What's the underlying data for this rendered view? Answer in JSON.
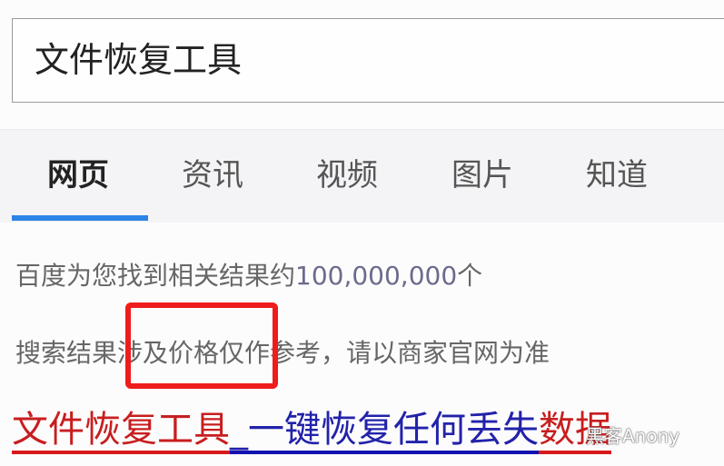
{
  "search": {
    "value": "文件恢复工具"
  },
  "tabs": [
    {
      "label": "网页",
      "active": true
    },
    {
      "label": "资讯"
    },
    {
      "label": "视频"
    },
    {
      "label": "图片"
    },
    {
      "label": "知道"
    }
  ],
  "results": {
    "count_prefix": "百度为您找到相关结果约",
    "count": "100,000,000",
    "count_suffix": "个",
    "notice": "搜索结果涉及价格仅作参考，请以商家官网为准"
  },
  "first_result": {
    "part1": "文件恢复工具",
    "part2": "_一键恢复任何丢失",
    "part3": "数据"
  },
  "watermark": "黑客Anony",
  "colors": {
    "tab_active": "#2c84e6",
    "highlight_box": "#ee1c1c",
    "link_red": "#c81e1e",
    "link_blue": "#2222aa"
  }
}
